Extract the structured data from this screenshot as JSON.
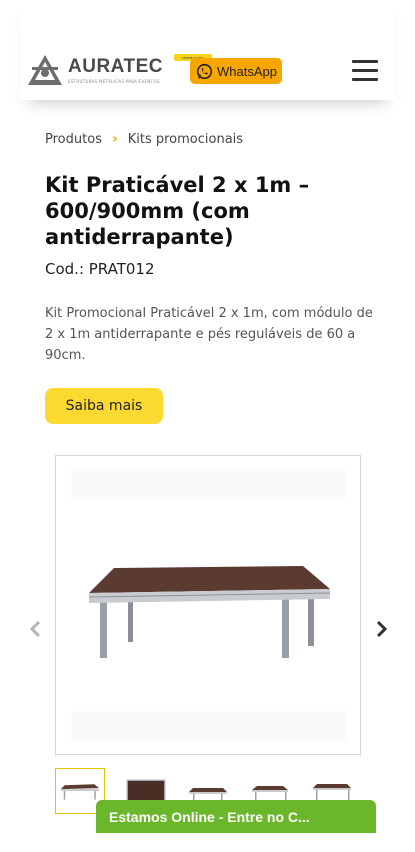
{
  "header": {
    "logo": {
      "name": "AURATEC",
      "tagline": "ESTRUTURAS METÁLICAS PARA EVENTOS",
      "icon": "auratec-logo-mark"
    },
    "whatsapp": {
      "label": "WhatsApp",
      "badge": "CHAME AGORA",
      "icon": "whatsapp-icon",
      "color": "#f7a600"
    },
    "menu_icon": "hamburger-menu-icon"
  },
  "breadcrumb": {
    "items": [
      "Produtos",
      "Kits promocionais"
    ],
    "separator": "›",
    "separator_color": "#f7a600"
  },
  "product": {
    "title": "Kit Praticável 2 x 1m – 600/900mm (com antiderrapante)",
    "code": "Cod.: PRAT012",
    "description": "Kit Promocional Praticável 2 x 1m, com módulo de 2 x 1m antiderrapante e pés reguláveis de 60 a 90cm.",
    "cta_label": "Saiba mais",
    "cta_color": "#fcd930"
  },
  "gallery": {
    "prev_icon": "chevron-left-icon",
    "next_icon": "chevron-right-icon",
    "main_image": "stage-platform-image",
    "thumbnail_count": 5,
    "active_thumbnail": 1
  },
  "chat": {
    "label": "Estamos Online - Entre no C...",
    "color": "#6ab72b"
  }
}
